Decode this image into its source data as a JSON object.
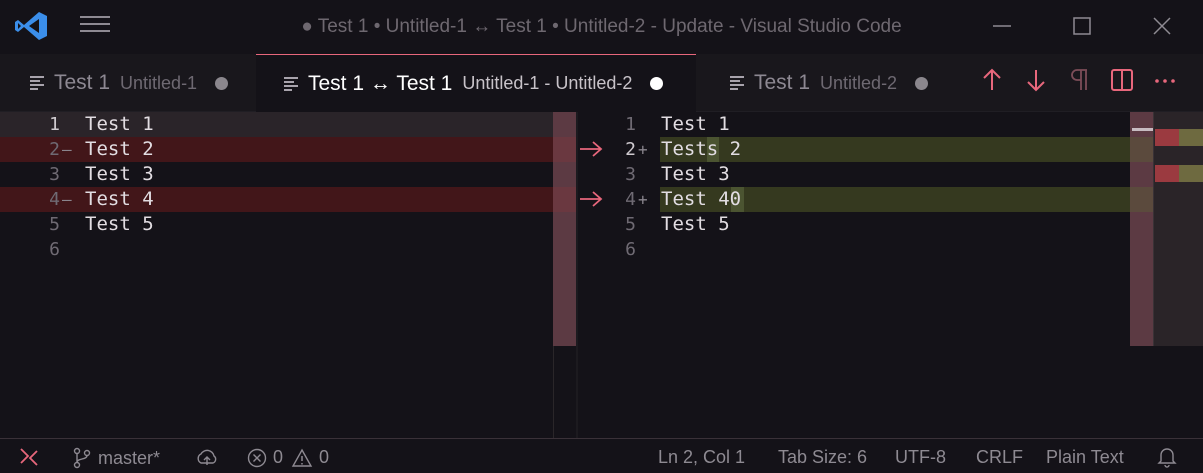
{
  "window": {
    "title": "● Test 1 • Untitled-1 ↔ Test 1 • Untitled-2 - Update - Visual Studio Code"
  },
  "tabs": [
    {
      "label": "Test 1",
      "sublabel": "Untitled-1",
      "dirty": true,
      "active": false
    },
    {
      "label": "Test 1 ↔ Test 1",
      "sublabel": "Untitled-1 - Untitled-2",
      "dirty": true,
      "active": true
    },
    {
      "label": "Test 1",
      "sublabel": "Untitled-2",
      "dirty": true,
      "active": false
    }
  ],
  "tab_actions": [
    "arrow-up-icon",
    "arrow-down-icon",
    "pilcrow-icon",
    "split-editor-icon",
    "more-icon"
  ],
  "left": {
    "lines": [
      {
        "n": "1",
        "text": "Test 1",
        "mark": ""
      },
      {
        "n": "2",
        "text": "Test 2",
        "mark": "—"
      },
      {
        "n": "3",
        "text": "Test 3",
        "mark": ""
      },
      {
        "n": "4",
        "text": "Test 4",
        "mark": "—"
      },
      {
        "n": "5",
        "text": "Test 5",
        "mark": ""
      },
      {
        "n": "6",
        "text": "",
        "mark": ""
      }
    ]
  },
  "right": {
    "lines": [
      {
        "n": "1",
        "text": "Test 1",
        "mark": ""
      },
      {
        "n": "2",
        "text": "Tests 2",
        "mark": "+"
      },
      {
        "n": "3",
        "text": "Test 3",
        "mark": ""
      },
      {
        "n": "4",
        "text": "Test 40",
        "mark": "+"
      },
      {
        "n": "5",
        "text": "Test 5",
        "mark": ""
      },
      {
        "n": "6",
        "text": "",
        "mark": ""
      }
    ]
  },
  "statusbar": {
    "branch": "master*",
    "errors": "0",
    "warnings": "0",
    "position": "Ln 2, Col 1",
    "tab_size": "Tab Size: 6",
    "encoding": "UTF-8",
    "eol": "CRLF",
    "language": "Plain Text"
  },
  "colors": {
    "accent": "#e8677c",
    "deleted_line": "#421619",
    "inserted_line": "#35391f",
    "inserted_word": "#4b5431",
    "logo": "#3b8eea"
  }
}
